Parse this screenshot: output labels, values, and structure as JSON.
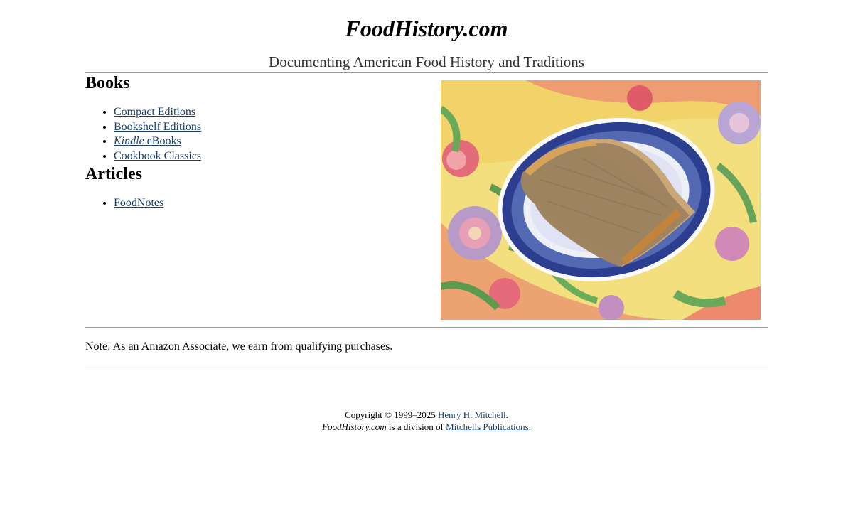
{
  "header": {
    "title": "FoodHistory.com",
    "tagline": "Documenting American Food History and Traditions"
  },
  "books": {
    "heading": "Books",
    "items": [
      {
        "label": "Compact Editions"
      },
      {
        "label": "Bookshelf Editions"
      },
      {
        "label_italic": "Kindle",
        "label": " eBooks"
      },
      {
        "label": "Cookbook Classics"
      }
    ]
  },
  "articles": {
    "heading": "Articles",
    "items": [
      {
        "label": "FoodNotes"
      }
    ]
  },
  "photo": {
    "subject": "sliced-bread-on-blue-willow-plate"
  },
  "note": {
    "text": "Note: As an Amazon Associate, we earn from qualifying purchases."
  },
  "footer": {
    "copyright_prefix": "Copyright © 1999–2025 ",
    "author_link": "Henry H. Mitchell",
    "copyright_suffix": ".",
    "site_italic": "FoodHistory.com",
    "division_text": " is a division of ",
    "publisher_link": "Mitchells Publications",
    "division_suffix": "."
  },
  "colors": {
    "link": "#1a3f6b",
    "rule": "#999999",
    "tagline": "#333333"
  }
}
